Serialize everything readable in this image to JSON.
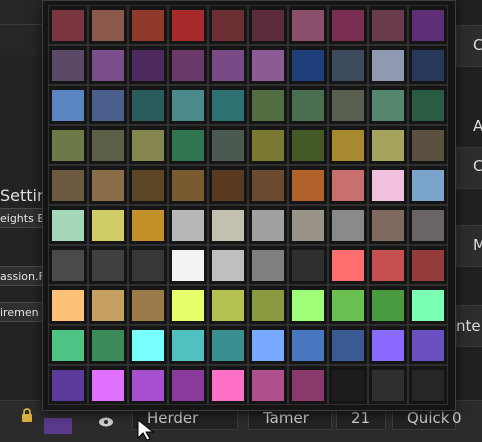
{
  "background": {
    "left": {
      "settings_label": "Setting",
      "weights_label": "eights B",
      "passion_label": "assion.F",
      "irement_label": "iremen"
    },
    "right": {
      "letters": [
        "C",
        "A",
        "C",
        "M",
        "nte"
      ]
    },
    "bottom_bar": {
      "field1": "Herder",
      "field2": "Tamer",
      "field3": "21",
      "field4": "Quick Sleep",
      "count": "0"
    }
  },
  "palette": {
    "rows": [
      [
        "#7a3540",
        "#8c5a4c",
        "#8f3a2a",
        "#a72b2b",
        "#6b2f34",
        "#5c2b3e",
        "#8c4f6b",
        "#7a2f52",
        "#6a3a4d",
        "#5e2f76"
      ],
      [
        "#5a4a66",
        "#7a4f8c",
        "#4d2a5e",
        "#6b3a6b",
        "#7a4a86",
        "#8c5a94",
        "#1f3f7a",
        "#3e4a5e",
        "#8f9ab0",
        "#27385a"
      ],
      [
        "#5a84c2",
        "#4a5f8c",
        "#2a5c5c",
        "#4a8a8a",
        "#2f7070",
        "#536e43",
        "#4a6e50",
        "#585f4e",
        "#55876e",
        "#2a5c44"
      ],
      [
        "#6c7a47",
        "#5c5e48",
        "#86864f",
        "#2f7552",
        "#4a5a50",
        "#7a7a32",
        "#455a26",
        "#a88a30",
        "#a5a45e",
        "#5c5040"
      ],
      [
        "#6b5a40",
        "#8a6e4a",
        "#5c4626",
        "#7a5a2f",
        "#5a3a20",
        "#6b4a30",
        "#b0622a",
        "#c87070",
        "#f0c0dc",
        "#7aa4cc"
      ],
      [
        "#a4d6b8",
        "#d0cc66",
        "#c4902a",
        "#b8b8b8",
        "#c4c0b0",
        "#a0a0a0",
        "#9a9488",
        "#8a8a8a",
        "#806a60",
        "#6a6464"
      ],
      [
        "#4a4a4a",
        "#404040",
        "#383838",
        "#f2f2f2",
        "#bfbfbf",
        "#808080",
        "#303030",
        "#ff6e6e",
        "#c45050",
        "#943c3c"
      ],
      [
        "#ffc078",
        "#c6a060",
        "#9a7a48",
        "#e6ff6a",
        "#b4c050",
        "#8a9a40",
        "#a0ff78",
        "#6ac050",
        "#4a9a40",
        "#7affb4"
      ],
      [
        "#50c484",
        "#3a8a5a",
        "#78ffff",
        "#50c0c0",
        "#3a9090",
        "#78aaff",
        "#4a78c0",
        "#3a5a94",
        "#8a6aff",
        "#6a50c0"
      ],
      [
        "#5a3a9a",
        "#e070ff",
        "#a650d0",
        "#8a3a9a",
        "#ff70c8",
        "#b0508a",
        "#8a3a6a",
        "#1c1c1c",
        "#303030",
        "#262626"
      ]
    ]
  }
}
